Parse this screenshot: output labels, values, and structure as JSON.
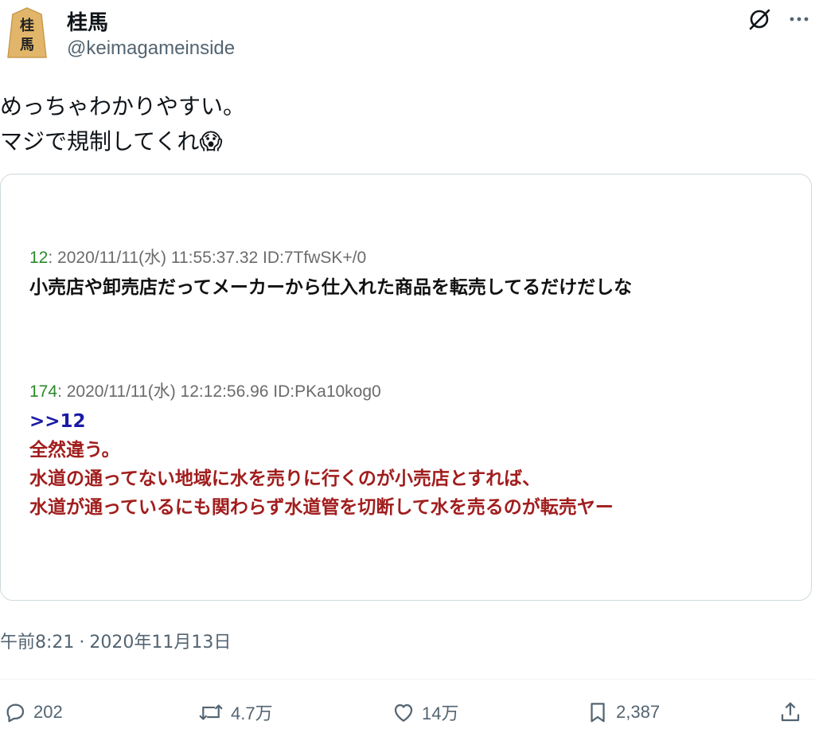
{
  "author": {
    "name": "桂馬",
    "handle": "@keimagameinside",
    "avatar_text": "桂馬"
  },
  "tweet": {
    "line1": "めっちゃわかりやすい。",
    "line2": "マジで規制してくれ",
    "emoji": "😱"
  },
  "card": {
    "posts": [
      {
        "number": "12",
        "header": ": 2020/11/11(水) 11:55:37.32 ID:7TfwSK+/0",
        "lines": [
          "小売店や卸売店だってメーカーから仕入れた商品を転売してるだけだしな"
        ]
      },
      {
        "number": "174",
        "header": ": 2020/11/11(水) 12:12:56.96 ID:PKa10kog0",
        "anchor": ">>12",
        "lines": [
          "全然違う。",
          "水道の通ってない地域に水を売りに行くのが小売店とすれば、",
          "水道が通っているにも関わらず水道管を切断して水を売るのが転売ヤー"
        ]
      }
    ]
  },
  "meta": {
    "time": "午前8:21",
    "separator": "·",
    "date": "2020年11月13日"
  },
  "actions": {
    "reply_count": "202",
    "retweet_count": "4.7万",
    "like_count": "14万",
    "bookmark_count": "2,387"
  },
  "icons": {
    "avatar": "shogi-piece-icon",
    "grok": "grok-icon",
    "more": "more-options-icon",
    "reply": "reply-icon",
    "retweet": "retweet-icon",
    "like": "heart-icon",
    "bookmark": "bookmark-icon",
    "share": "share-icon"
  },
  "colors": {
    "text_primary": "#0f1419",
    "text_secondary": "#536471",
    "post_number": "#2b8a2b",
    "anchor": "#1a1aa6",
    "reply_text": "#a11d1d",
    "card_border": "#cfd9de"
  }
}
